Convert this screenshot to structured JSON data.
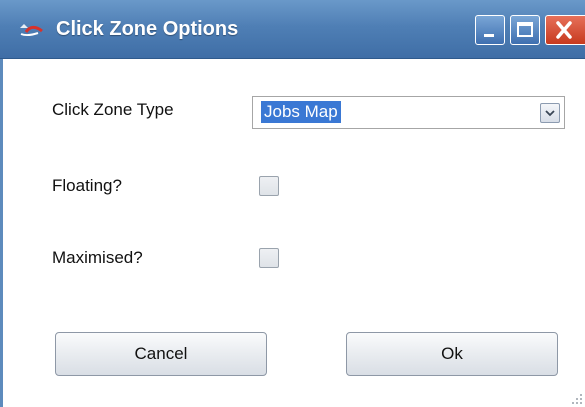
{
  "window": {
    "title": "Click Zone Options",
    "title_bar_color": "#4f7fb5",
    "icon": "click-zone-app-icon",
    "controls": [
      "minimize-icon",
      "maximize-icon",
      "close-icon"
    ]
  },
  "form": {
    "click_zone_type": {
      "label": "Click Zone Type",
      "selected_value": "Jobs Map",
      "selection_color": "#3a78d4"
    },
    "floating": {
      "label": "Floating?",
      "checked": false
    },
    "maximised": {
      "label": "Maximised?",
      "checked": false
    }
  },
  "buttons": {
    "cancel_label": "Cancel",
    "ok_label": "Ok"
  }
}
